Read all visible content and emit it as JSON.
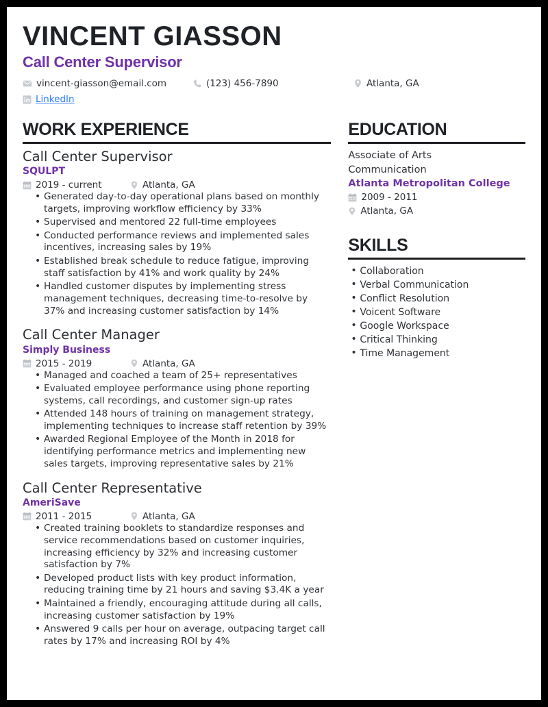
{
  "header": {
    "name": "VINCENT GIASSON",
    "role": "Call Center Supervisor",
    "accent_color": "#6f31a8",
    "link_color": "#2f7ef7",
    "contacts": {
      "email": "vincent-giasson@email.com",
      "email_icon": "envelope-icon",
      "phone": "(123) 456-7890",
      "phone_icon": "phone-icon",
      "location": "Atlanta, GA",
      "location_icon": "map-pin-icon",
      "linkedin_label": "LinkedIn",
      "linkedin_icon": "linkedin-icon"
    }
  },
  "work_experience": {
    "section_title": "WORK EXPERIENCE",
    "jobs": [
      {
        "title": "Call Center Supervisor",
        "company": "SQULPT",
        "dates": "2019 - current",
        "location": "Atlanta, GA",
        "date_icon": "calendar-icon",
        "location_icon": "map-pin-icon",
        "bullets": [
          "Generated day-to-day operational plans based on monthly targets, improving workflow efficiency by 33%",
          "Supervised and mentored 22 full-time employees",
          "Conducted performance reviews and implemented sales incentives, increasing sales by 19%",
          "Established break schedule to reduce fatigue, improving staff satisfaction by 41% and work quality by 24%",
          "Handled customer disputes by implementing stress management techniques, decreasing time-to-resolve by 37% and increasing customer satisfaction by 14%"
        ]
      },
      {
        "title": "Call Center Manager",
        "company": "Simply Business",
        "dates": "2015 - 2019",
        "location": "Atlanta, GA",
        "date_icon": "calendar-icon",
        "location_icon": "map-pin-icon",
        "bullets": [
          "Managed and coached a team of 25+ representatives",
          "Evaluated employee performance using phone reporting systems, call recordings, and customer sign-up rates",
          "Attended 148 hours of training on management strategy, implementing techniques to increase staff retention by 39%",
          "Awarded Regional Employee of the Month in 2018 for identifying performance metrics and implementing new sales targets, improving representative sales by 21%"
        ]
      },
      {
        "title": "Call Center Representative",
        "company": "AmeriSave",
        "dates": "2011 - 2015",
        "location": "Atlanta, GA",
        "date_icon": "calendar-icon",
        "location_icon": "map-pin-icon",
        "bullets": [
          "Created training booklets to standardize responses and service recommendations based on customer inquiries, increasing efficiency by 32% and increasing customer satisfaction by 7%",
          "Developed product lists with key product information, reducing training time by 21 hours and saving $3.4K a year",
          "Maintained a friendly, encouraging attitude during all calls, increasing customer satisfaction by 19%",
          "Answered 9 calls per hour on average, outpacing target call rates by 17% and increasing ROI by 4%"
        ]
      }
    ]
  },
  "education": {
    "section_title": "EDUCATION",
    "entries": [
      {
        "degree": "Associate of Arts",
        "field": "Communication",
        "school": "Atlanta Metropolitan College",
        "dates": "2009 - 2011",
        "location": "Atlanta, GA",
        "date_icon": "calendar-icon",
        "location_icon": "map-pin-icon"
      }
    ]
  },
  "skills": {
    "section_title": "SKILLS",
    "items": [
      "Collaboration",
      "Verbal Communication",
      "Conflict Resolution",
      "Voicent Software",
      "Google Workspace",
      "Critical Thinking",
      "Time Management"
    ]
  }
}
